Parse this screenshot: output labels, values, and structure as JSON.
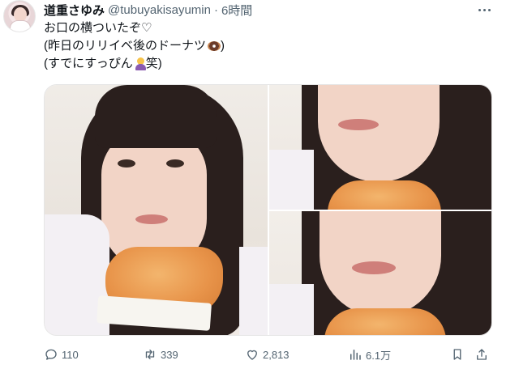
{
  "author": {
    "display_name": "道重さゆみ",
    "handle": "@tubuyakisayumin",
    "separator": "·",
    "time": "6時間"
  },
  "tweet": {
    "lines": [
      "お口の横ついたぞ♡",
      "(昨日のリリイベ後のドーナツ",
      "(すでにすっぴん",
      "笑)"
    ],
    "line2_suffix": ")",
    "emoji": {
      "line2": "doughnut-emoji",
      "line3": "person-gesturing-emoji"
    }
  },
  "media": {
    "photo_count": 3
  },
  "actions": {
    "replies": "110",
    "retweets": "339",
    "likes": "2,813",
    "views": "6.1万"
  },
  "colors": {
    "text": "#0f1419",
    "secondary": "#536471",
    "border": "#e6e6e6",
    "retweet_accent": "#536471"
  },
  "icons": [
    "more-icon",
    "reply-icon",
    "retweet-icon",
    "like-icon",
    "views-icon",
    "bookmark-icon",
    "share-icon"
  ]
}
